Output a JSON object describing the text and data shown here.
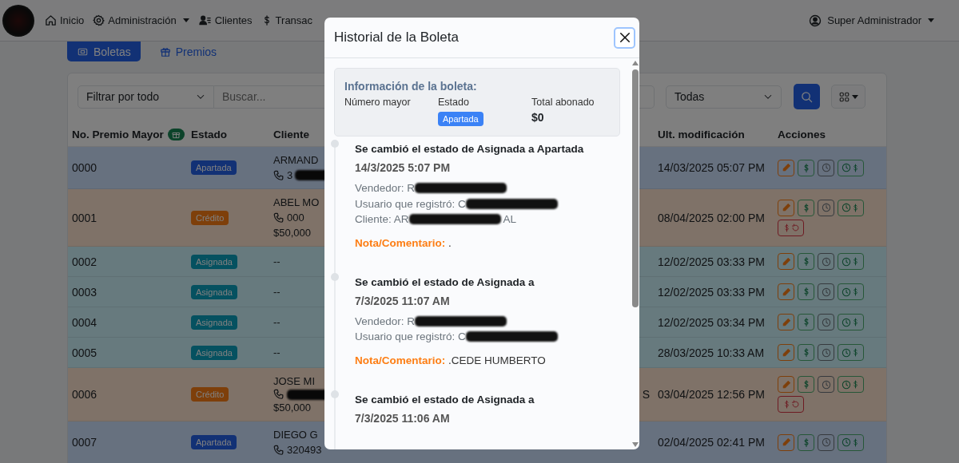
{
  "navbar": {
    "items": [
      {
        "label": "Inicio",
        "dropdown": false
      },
      {
        "label": "Administración",
        "dropdown": true
      },
      {
        "label": "Clientes",
        "dropdown": false
      },
      {
        "label": "Transac",
        "dropdown": false
      }
    ],
    "user": {
      "label": "Super Administrador"
    }
  },
  "tabs": [
    {
      "label": "Boletas",
      "selected": true
    },
    {
      "label": "Premios",
      "selected": false
    }
  ],
  "filters": {
    "filter_select": "Filtrar por todo",
    "search": {
      "placeholder": "Buscar..."
    },
    "status_select": "Todas"
  },
  "table": {
    "columns": [
      {
        "label": "No. Premio Mayor"
      },
      {
        "label": "Estado"
      },
      {
        "label": "Cliente"
      },
      {
        "label": "Ult. modificación"
      },
      {
        "label": "Acciones"
      }
    ],
    "rows": [
      {
        "number": "0000",
        "status": "Apartada",
        "kind": "apartada",
        "client": {
          "name": "ARMAND",
          "phone": "3",
          "redacted": true
        },
        "modified": "14/03/2025 05:07 PM",
        "actions": [
          {
            "kind": "edit"
          },
          {
            "kind": "pay"
          },
          {
            "kind": "history"
          },
          {
            "kind": "history_pay"
          }
        ]
      },
      {
        "number": "0001",
        "status": "Crédito",
        "kind": "credito",
        "client": {
          "name": "ABEL MO",
          "phone": "000",
          "amount": "$50,000"
        },
        "modified": "08/04/2025 02:00 PM",
        "actions": [
          {
            "kind": "edit"
          },
          {
            "kind": "pay"
          },
          {
            "kind": "history"
          },
          {
            "kind": "history_pay"
          },
          {
            "kind": "refund"
          }
        ]
      },
      {
        "number": "0002",
        "status": "Asignada",
        "kind": "asignada",
        "client": {
          "name": "--"
        },
        "modified": "12/02/2025 03:33 PM",
        "actions": [
          {
            "kind": "edit"
          },
          {
            "kind": "pay"
          },
          {
            "kind": "history"
          },
          {
            "kind": "history_pay"
          }
        ]
      },
      {
        "number": "0003",
        "status": "Asignada",
        "kind": "asignada",
        "client": {
          "name": "--"
        },
        "modified": "12/02/2025 03:33 PM",
        "actions": [
          {
            "kind": "edit"
          },
          {
            "kind": "pay"
          },
          {
            "kind": "history"
          },
          {
            "kind": "history_pay"
          }
        ]
      },
      {
        "number": "0004",
        "status": "Asignada",
        "kind": "asignada",
        "client": {
          "name": "--"
        },
        "modified": "12/02/2025 03:34 PM",
        "actions": [
          {
            "kind": "edit"
          },
          {
            "kind": "pay"
          },
          {
            "kind": "history"
          },
          {
            "kind": "history_pay"
          }
        ]
      },
      {
        "number": "0005",
        "status": "Asignada",
        "kind": "asignada",
        "client": {
          "name": "--"
        },
        "modified": "28/03/2025 10:33 AM",
        "actions": [
          {
            "kind": "edit"
          },
          {
            "kind": "pay"
          },
          {
            "kind": "history"
          },
          {
            "kind": "history_pay"
          }
        ]
      },
      {
        "number": "0006",
        "status": "Crédito",
        "kind": "credito",
        "client": {
          "name": "JOSE MI",
          "redacted": true,
          "amount": "$50,000"
        },
        "column_4": "S",
        "modified": "03/04/2025 12:56 PM",
        "actions": [
          {
            "kind": "edit"
          },
          {
            "kind": "pay"
          },
          {
            "kind": "history"
          },
          {
            "kind": "history_pay"
          },
          {
            "kind": "refund"
          }
        ]
      },
      {
        "number": "0007",
        "status": "Apartada",
        "kind": "apartada",
        "client": {
          "name": "DIEGO G",
          "phone": "320493"
        },
        "modified": "02/04/2025 02:41 PM",
        "actions": [
          {
            "kind": "edit"
          },
          {
            "kind": "pay"
          },
          {
            "kind": "history"
          },
          {
            "kind": "history_pay"
          }
        ]
      }
    ]
  },
  "modal": {
    "title": "Historial de la Boleta",
    "info": {
      "title": "Información de la boleta:",
      "fields": [
        {
          "label": "Número mayor"
        },
        {
          "label": "Estado",
          "badge": "Apartada"
        },
        {
          "label": "Total abonado",
          "value": "$0"
        }
      ]
    },
    "history": [
      {
        "title": "Se cambió el estado de Asignada a Apartada",
        "date": "14/3/2025 5:07 PM",
        "details": [
          {
            "text": "Vendedor: R",
            "redacted": true
          },
          {
            "text": "Usuario que registró: C",
            "redacted": true
          },
          {
            "text": "Cliente: AR",
            "redacted": true,
            "suffix": "AL"
          }
        ],
        "note_label": "Nota/Comentario:",
        "note": "."
      },
      {
        "title": "Se cambió el estado de Asignada a",
        "date": "7/3/2025 11:07 AM",
        "details": [
          {
            "text": "Vendedor: R",
            "redacted": true
          },
          {
            "text": "Usuario que registró: C",
            "redacted": true
          }
        ],
        "note_label": "Nota/Comentario:",
        "note": ".CEDE HUMBERTO"
      },
      {
        "title": "Se cambió el estado de Asignada a",
        "date": "7/3/2025 11:06 AM"
      }
    ]
  }
}
